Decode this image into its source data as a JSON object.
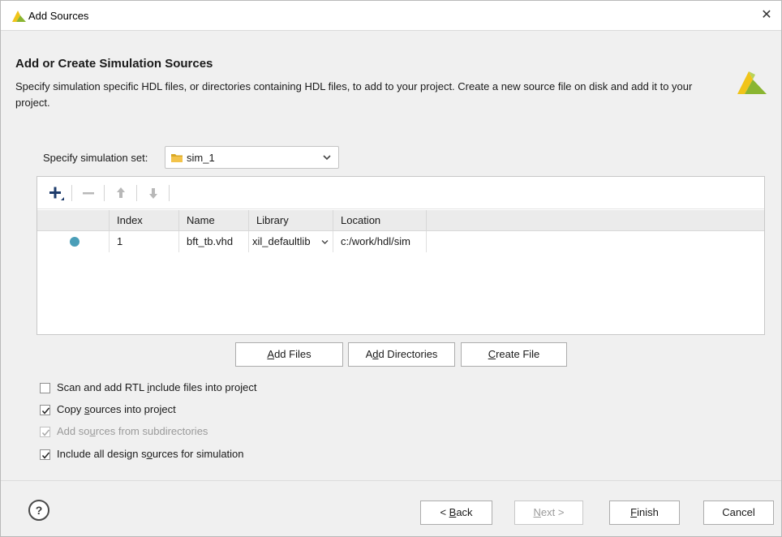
{
  "window": {
    "title": "Add Sources",
    "close_symbol": "✕"
  },
  "header": {
    "title": "Add or Create Simulation Sources",
    "description": "Specify simulation specific HDL files, or directories containing HDL files, to add to your project. Create a new source file on disk and add it to your project."
  },
  "simulation_set": {
    "label": "Specify simulation set:",
    "value": "sim_1"
  },
  "toolbar": {
    "icons": [
      "add-icon",
      "remove-icon",
      "move-up-icon",
      "move-down-icon"
    ]
  },
  "table": {
    "columns": [
      "Index",
      "Name",
      "Library",
      "Location"
    ],
    "rows": [
      {
        "status": "teal-dot",
        "index": "1",
        "name": "bft_tb.vhd",
        "library": "xil_defaultlib",
        "location": "c:/work/hdl/sim"
      }
    ]
  },
  "actions": {
    "add_files": {
      "pre": "",
      "mnemonic": "A",
      "post": "dd Files"
    },
    "add_directories": {
      "pre": "A",
      "mnemonic": "d",
      "post": "d Directories"
    },
    "create_file": {
      "pre": "",
      "mnemonic": "C",
      "post": "reate File"
    }
  },
  "options": [
    {
      "pre": "Scan and add RTL ",
      "mnemonic": "i",
      "post": "nclude files into project",
      "checked": false,
      "enabled": true
    },
    {
      "pre": "Copy ",
      "mnemonic": "s",
      "post": "ources into project",
      "checked": true,
      "enabled": true
    },
    {
      "pre": "Add so",
      "mnemonic": "u",
      "post": "rces from subdirectories",
      "checked": true,
      "enabled": false
    },
    {
      "pre": "Include all design s",
      "mnemonic": "o",
      "post": "urces for simulation",
      "checked": true,
      "enabled": true
    }
  ],
  "footer": {
    "help_symbol": "?",
    "back": {
      "pre": "< ",
      "mnemonic": "B",
      "post": "ack"
    },
    "next": {
      "pre": "",
      "mnemonic": "N",
      "post": "ext >"
    },
    "finish": {
      "pre": "",
      "mnemonic": "F",
      "post": "inish"
    },
    "cancel": "Cancel"
  },
  "colors": {
    "status_dot": "#4a9eb8",
    "logo_green": "#8ab531",
    "logo_yellow": "#f0c419",
    "folder": "#d9a824"
  }
}
